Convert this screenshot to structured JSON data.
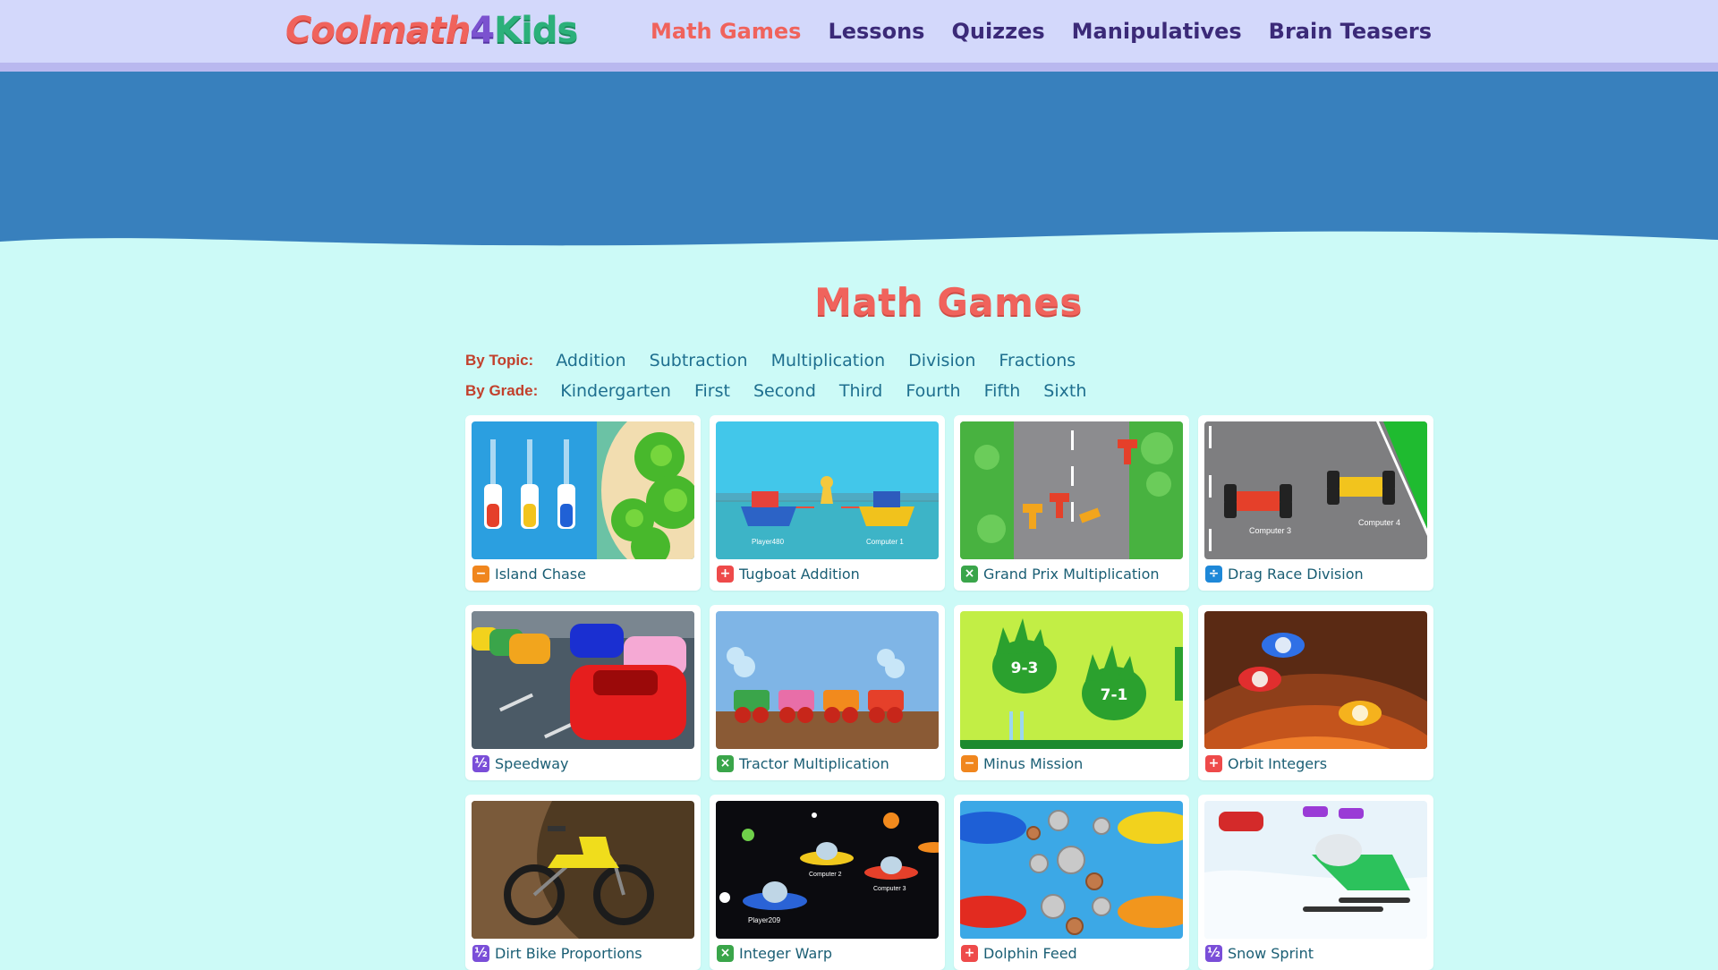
{
  "site": {
    "logo_part1": "Coolmath",
    "logo_part2": "4",
    "logo_part3": "Kids"
  },
  "nav": [
    {
      "label": "Math Games",
      "active": true
    },
    {
      "label": "Lessons",
      "active": false
    },
    {
      "label": "Quizzes",
      "active": false
    },
    {
      "label": "Manipulatives",
      "active": false
    },
    {
      "label": "Brain Teasers",
      "active": false
    }
  ],
  "page": {
    "title": "Math Games"
  },
  "filters": {
    "topic_label": "By Topic:",
    "topics": [
      "Addition",
      "Subtraction",
      "Multiplication",
      "Division",
      "Fractions"
    ],
    "grade_label": "By Grade:",
    "grades": [
      "Kindergarten",
      "First",
      "Second",
      "Third",
      "Fourth",
      "Fifth",
      "Sixth"
    ]
  },
  "colors": {
    "accent": "#f0635c",
    "nav_bg": "#d3d8fb",
    "banner": "#3880bd",
    "page_bg": "#ccfaf7",
    "minus": "#f0861e",
    "plus": "#ee4a4a",
    "times": "#3aa54a",
    "divide": "#1e88d8",
    "fraction": "#7a4ed8"
  },
  "games": [
    {
      "title": "Island Chase",
      "op": "minus",
      "icon_symbol": "−",
      "art": "island-chase"
    },
    {
      "title": "Tugboat Addition",
      "op": "plus",
      "icon_symbol": "+",
      "art": "tugboat-addition",
      "art_text": [
        "Player480",
        "Computer 1"
      ]
    },
    {
      "title": "Grand Prix Multiplication",
      "op": "times",
      "icon_symbol": "×",
      "art": "grand-prix"
    },
    {
      "title": "Drag Race Division",
      "op": "divide",
      "icon_symbol": "÷",
      "art": "drag-race",
      "art_text": [
        "Computer 3",
        "Computer 4"
      ]
    },
    {
      "title": "Speedway",
      "op": "fraction",
      "icon_symbol": "½",
      "art": "speedway"
    },
    {
      "title": "Tractor Multiplication",
      "op": "times",
      "icon_symbol": "×",
      "art": "tractor"
    },
    {
      "title": "Minus Mission",
      "op": "minus",
      "icon_symbol": "−",
      "art": "minus-mission",
      "art_text": [
        "9-3",
        "7-1"
      ]
    },
    {
      "title": "Orbit Integers",
      "op": "plus",
      "icon_symbol": "+",
      "art": "orbit-integers"
    },
    {
      "title": "Dirt Bike Proportions",
      "op": "fraction",
      "icon_symbol": "½",
      "art": "dirt-bike"
    },
    {
      "title": "Integer Warp",
      "op": "times",
      "icon_symbol": "×",
      "art": "integer-warp",
      "art_text": [
        "Computer 2",
        "Computer 3",
        "Player209"
      ]
    },
    {
      "title": "Dolphin Feed",
      "op": "plus",
      "icon_symbol": "+",
      "art": "dolphin-feed"
    },
    {
      "title": "Snow Sprint",
      "op": "fraction",
      "icon_symbol": "½",
      "art": "snow-sprint"
    }
  ]
}
